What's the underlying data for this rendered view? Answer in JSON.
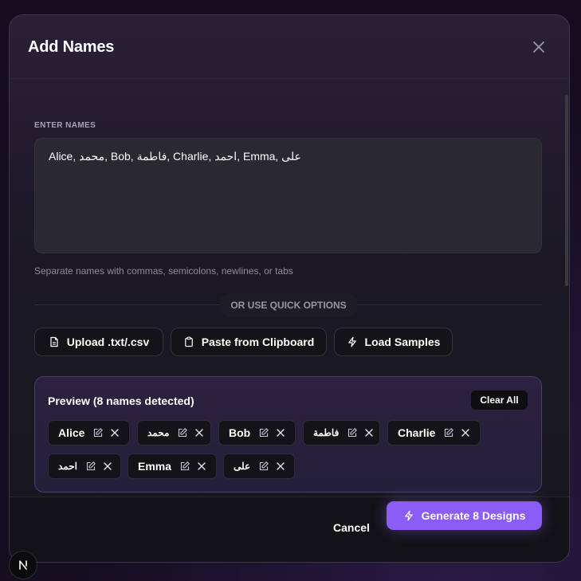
{
  "modal": {
    "title": "Add Names"
  },
  "input_section": {
    "label": "ENTER NAMES",
    "value": "Alice, محمد, Bob, فاطمة, Charlie, احمد, Emma, على",
    "hint": "Separate names with commas, semicolons, newlines, or tabs"
  },
  "quick_options": {
    "divider_text": "OR USE QUICK OPTIONS",
    "buttons": [
      {
        "label": "Upload .txt/.csv",
        "icon": "file-icon"
      },
      {
        "label": "Paste from Clipboard",
        "icon": "clipboard-icon"
      },
      {
        "label": "Load Samples",
        "icon": "lightning-icon"
      }
    ]
  },
  "preview": {
    "title": "Preview (8 names detected)",
    "clear_all_label": "Clear All",
    "chips": [
      {
        "label": "Alice"
      },
      {
        "label": "محمد"
      },
      {
        "label": "Bob"
      },
      {
        "label": "فاطمة"
      },
      {
        "label": "Charlie"
      },
      {
        "label": "احمد"
      },
      {
        "label": "Emma"
      },
      {
        "label": "على"
      }
    ]
  },
  "footer": {
    "cancel_label": "Cancel",
    "generate_label": "Generate 8 Designs"
  },
  "colors": {
    "accent": "#8b5cf6",
    "preview_border": "#4b3c72",
    "surface": "#141318"
  }
}
